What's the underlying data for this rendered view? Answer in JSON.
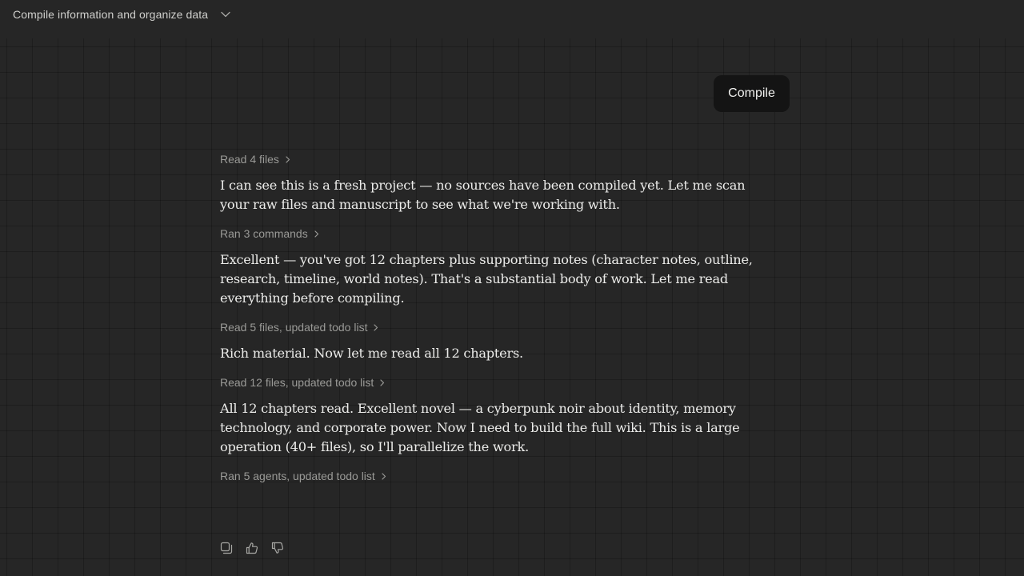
{
  "header": {
    "title": "Compile information and organize data"
  },
  "user_message": {
    "text": "Compile"
  },
  "conversation": [
    {
      "tool_summary": "Read 4 files",
      "message": "I can see this is a fresh project — no sources have been compiled yet. Let me scan your raw files and manuscript to see what we're working with."
    },
    {
      "tool_summary": "Ran 3 commands",
      "message": "Excellent — you've got 12 chapters plus supporting notes (character notes, outline, research, timeline, world notes). That's a substantial body of work. Let me read everything before compiling."
    },
    {
      "tool_summary": "Read 5 files, updated todo list",
      "message": "Rich material. Now let me read all 12 chapters."
    },
    {
      "tool_summary": "Read 12 files, updated todo list",
      "message": "All 12 chapters read. Excellent novel — a cyberpunk noir about identity, memory technology, and corporate power. Now I need to build the full wiki. This is a large operation (40+ files), so I'll parallelize the work."
    },
    {
      "tool_summary": "Ran 5 agents, updated todo list"
    }
  ],
  "actions": {
    "icons": [
      "copy-icon",
      "thumbs-up-icon",
      "thumbs-down-icon"
    ]
  },
  "colors": {
    "background": "#262626",
    "bubble": "#141414",
    "muted_text": "#9a9a97",
    "body_text": "#ececea"
  }
}
